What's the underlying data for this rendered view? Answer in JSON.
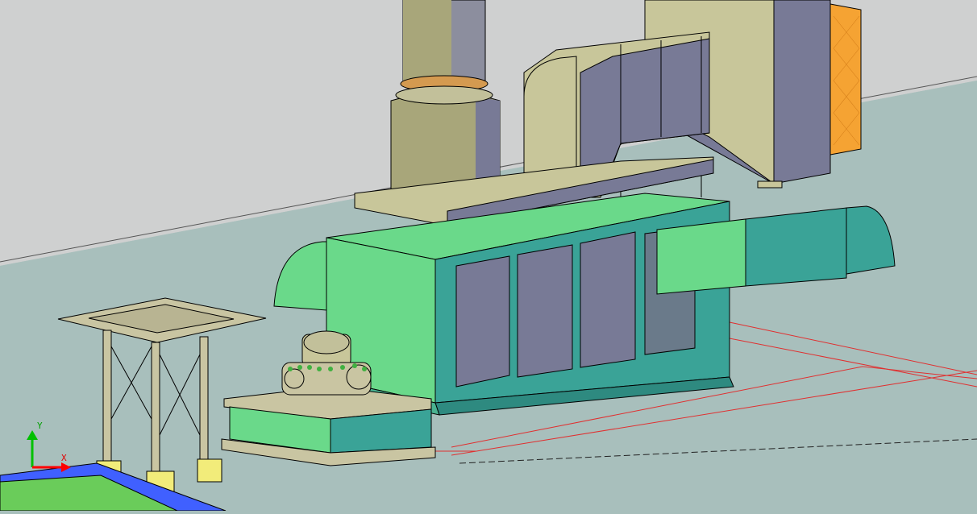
{
  "viewport": {
    "background_color": "#a8bfbc",
    "backdrop_color": "#cfd0d0",
    "visual_style": "shaded-with-edges"
  },
  "ucs_icon": {
    "x_label": "X",
    "y_label": "Y",
    "x_color": "#ff0000",
    "y_color": "#00c000"
  },
  "model": {
    "objects": [
      "enclosure-green",
      "exhaust-stack",
      "air-intake-duct",
      "filter-house",
      "side-duct",
      "top-railing",
      "enclosure-doors",
      "pump-skid",
      "pump",
      "pipe-support-rack",
      "foreground-pipe",
      "layout-lines"
    ],
    "colors": {
      "enclosure": "#6ad98a",
      "enclosure_dark": "#3aa397",
      "stack": "#a8a67a",
      "duct_gray": "#787a96",
      "duct_khaki": "#c8c69a",
      "filter_orange": "#f5a333",
      "rack_beige": "#c9c5a2",
      "footing_yellow": "#f2ec7a",
      "pipe_green": "#6acc5a",
      "pipe_blue": "#4060ff",
      "layout_red": "#e03030"
    }
  }
}
